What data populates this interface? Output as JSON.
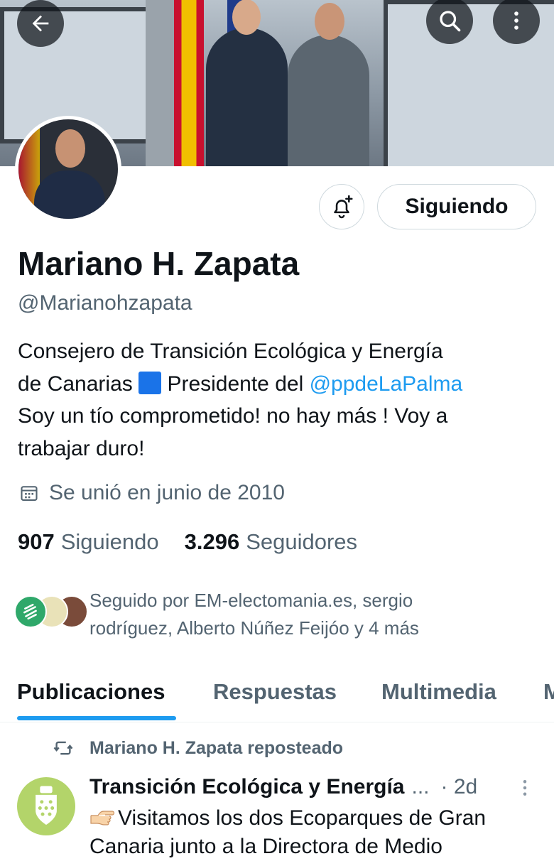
{
  "header": {
    "back_icon": "arrow-left-icon",
    "search_icon": "search-icon",
    "more_icon": "more-vertical-icon"
  },
  "profile": {
    "name": "Mariano H. Zapata",
    "handle": "@Marianohzapata",
    "follow_button_label": "Siguiendo",
    "notify_icon": "bell-plus-icon",
    "bio": {
      "line1": "Consejero de Transición Ecológica y Energía",
      "line2_before": "de Canarias",
      "line2_middle": " Presidente del ",
      "mention": "@ppdeLaPalma",
      "line3": "Soy un tío comprometido! no hay más ! Voy a",
      "line4": "trabajar duro!"
    },
    "joined_text": "Se unió en junio de 2010",
    "following_count": "907",
    "following_label": "Siguiendo",
    "followers_count": "3.296",
    "followers_label": "Seguidores",
    "followed_by_line1": "Seguido por EM-electomania.es, sergio",
    "followed_by_line2": "rodríguez, Alberto Núñez Feijóo y 4 más"
  },
  "tabs": [
    {
      "label": "Publicaciones",
      "active": true
    },
    {
      "label": "Respuestas",
      "active": false
    },
    {
      "label": "Multimedia",
      "active": false
    },
    {
      "label": "M",
      "active": false
    }
  ],
  "post": {
    "repost_text": "Mariano H. Zapata reposteado",
    "author": "Transición Ecológica y Energía",
    "ellipsis": "...",
    "time": "· 2d",
    "text_line1": "Visitamos los dos Ecoparques de Gran",
    "text_line2": "Canaria junto a la Directora de Medio"
  },
  "colors": {
    "accent": "#1d9bf0",
    "text_primary": "#0f1419",
    "text_secondary": "#536471"
  }
}
